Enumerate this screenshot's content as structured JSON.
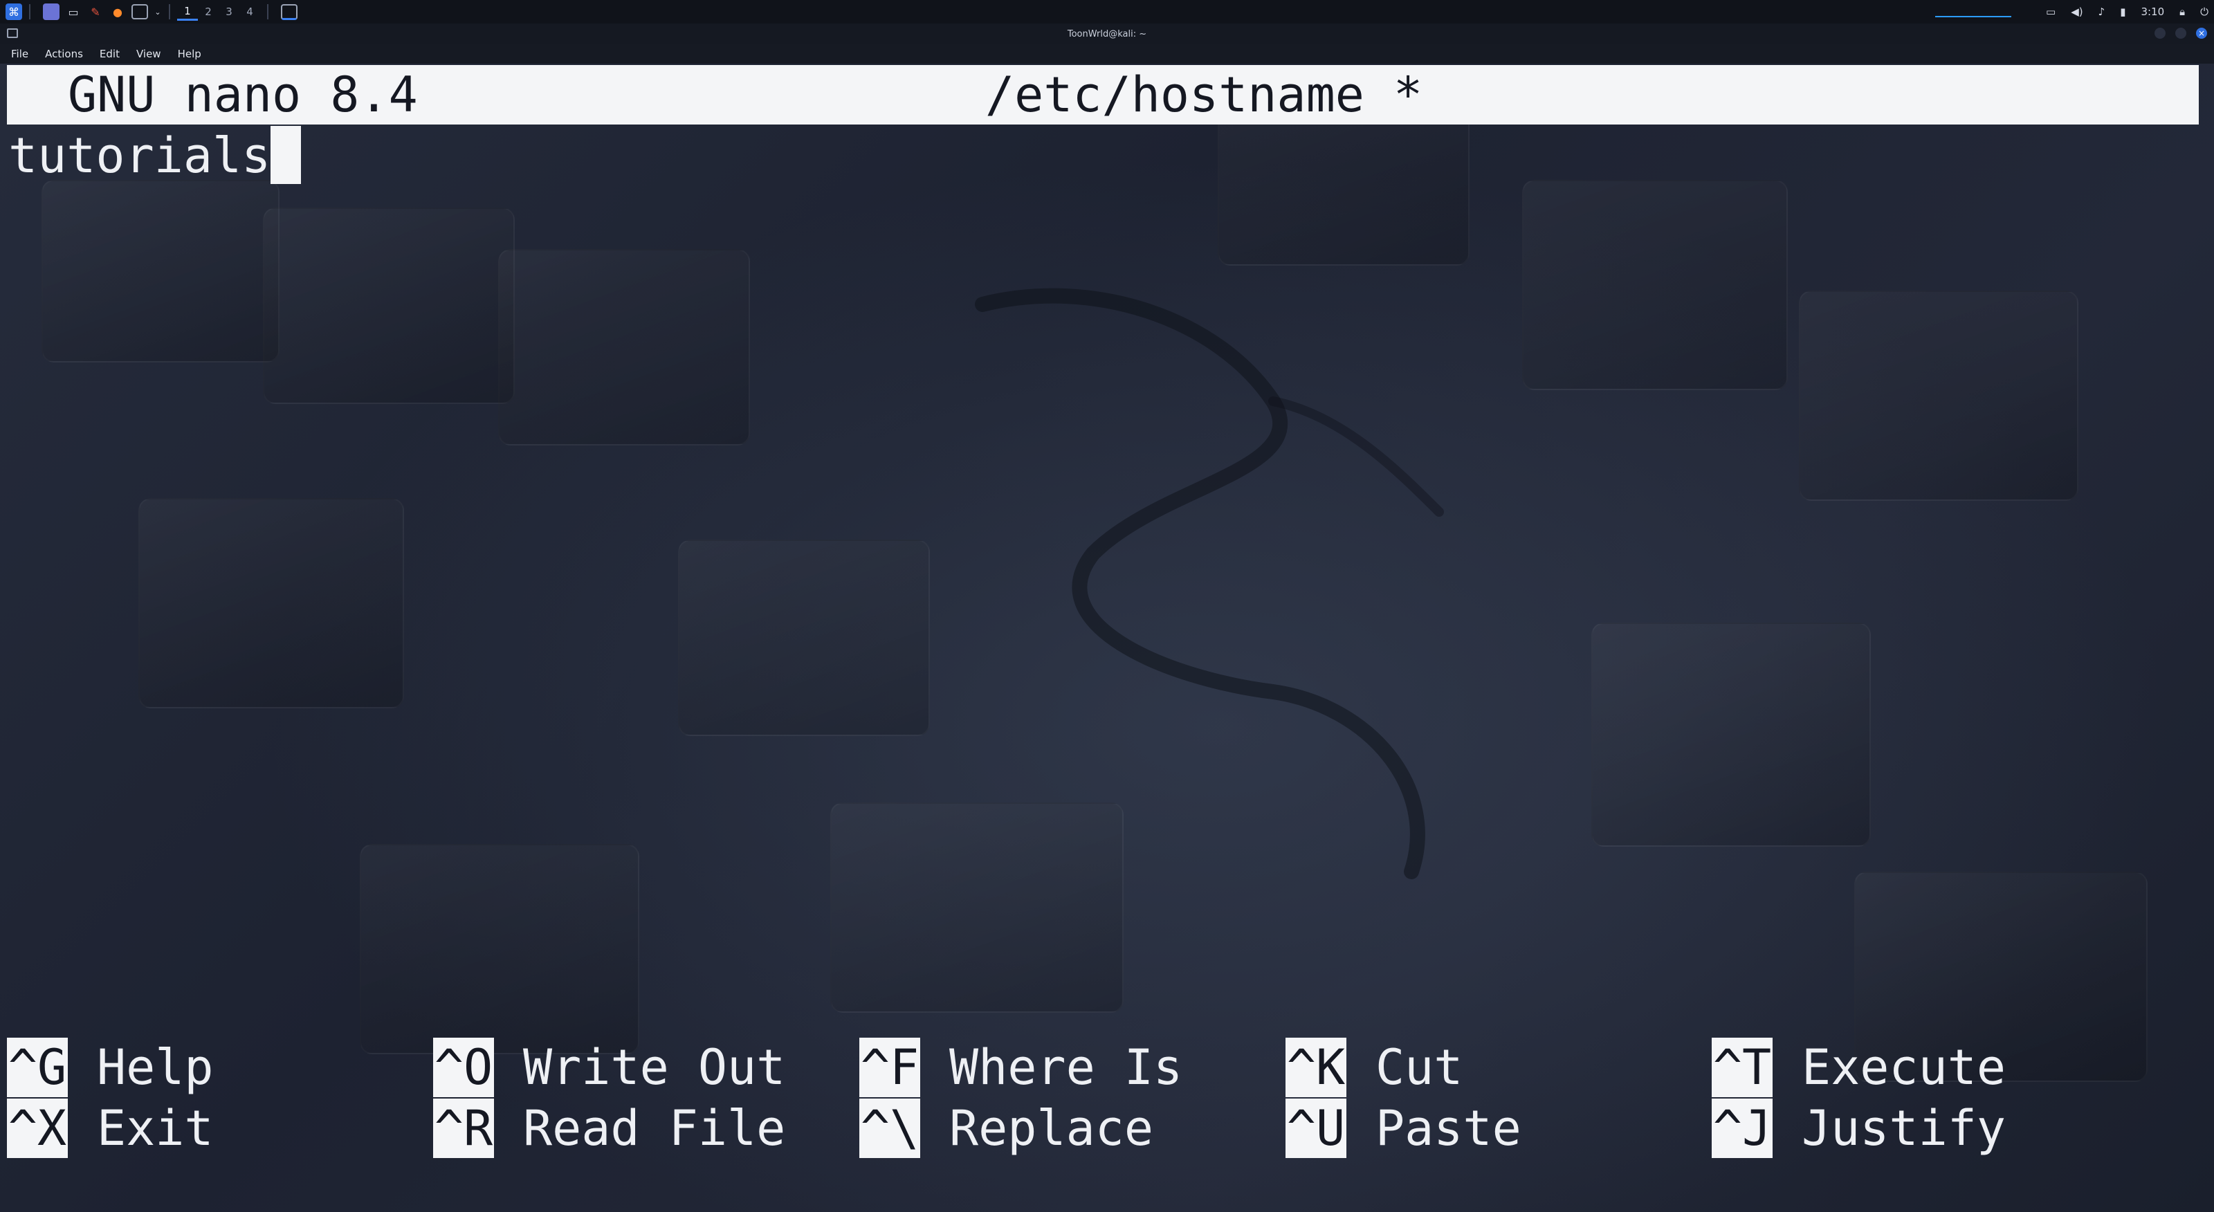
{
  "taskbar": {
    "workspaces": [
      "1",
      "2",
      "3",
      "4"
    ],
    "active_workspace": "1",
    "clock": "3:10",
    "icons": [
      "kali-menu-icon",
      "show-desktop-icon",
      "file-manager-icon",
      "text-editor-icon",
      "firefox-icon",
      "terminal-icon"
    ],
    "tray_icons": [
      "display-icon",
      "volume-icon",
      "notification-bell-icon",
      "battery-icon",
      "lock-icon",
      "power-icon"
    ]
  },
  "window": {
    "title": "ToonWrld@kali: ~",
    "menu": [
      "File",
      "Actions",
      "Edit",
      "View",
      "Help"
    ]
  },
  "nano": {
    "version_label": "GNU nano 8.4",
    "filename": "/etc/hostname *",
    "content_line": "tutorials",
    "shortcuts_row1": [
      {
        "key": "^G",
        "label": "Help"
      },
      {
        "key": "^O",
        "label": "Write Out"
      },
      {
        "key": "^F",
        "label": "Where Is"
      },
      {
        "key": "^K",
        "label": "Cut"
      },
      {
        "key": "^T",
        "label": "Execute"
      }
    ],
    "shortcuts_row2": [
      {
        "key": "^X",
        "label": "Exit"
      },
      {
        "key": "^R",
        "label": "Read File"
      },
      {
        "key": "^\\",
        "label": "Replace"
      },
      {
        "key": "^U",
        "label": "Paste"
      },
      {
        "key": "^J",
        "label": "Justify"
      }
    ]
  },
  "colors": {
    "background": "#1f2433",
    "header_bg": "#f4f5f7",
    "text": "#eef0f4",
    "accent": "#3b82f6"
  }
}
